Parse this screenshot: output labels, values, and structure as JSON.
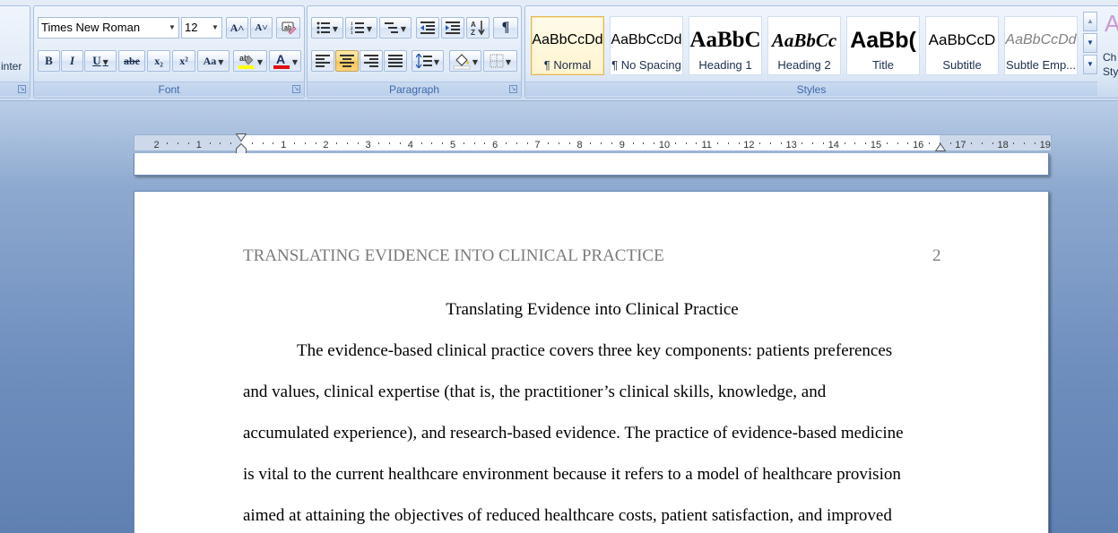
{
  "clipboard": {
    "partial_label": "inter"
  },
  "font_group": {
    "label": "Font",
    "font_name": "Times New Roman",
    "font_size": "12",
    "grow_icon": "A˄",
    "shrink_icon": "A˅",
    "bold": "B",
    "italic": "I",
    "underline": "U",
    "strikethrough": "abe",
    "subscript": "x₂",
    "superscript": "x²",
    "change_case": "Aa",
    "highlight_color": "#ffff00",
    "font_color": "#e01010"
  },
  "paragraph_group": {
    "label": "Paragraph",
    "show_marks": "¶"
  },
  "styles_group": {
    "label": "Styles",
    "tiles": [
      {
        "preview": "AaBbCcDd",
        "name": "¶ Normal"
      },
      {
        "preview": "AaBbCcDd",
        "name": "¶ No Spacing"
      },
      {
        "preview": "AaBbC",
        "name": "Heading 1"
      },
      {
        "preview": "AaBbCc",
        "name": "Heading 2"
      },
      {
        "preview": "AaBb(",
        "name": "Title"
      },
      {
        "preview": "AaBbCcD",
        "name": "Subtitle"
      },
      {
        "preview": "AaBbCcDd",
        "name": "Subtle Emp..."
      }
    ],
    "change_styles_partial": [
      "Ch",
      "Sty"
    ]
  },
  "ruler": {
    "left_labels": [
      "2",
      "1"
    ],
    "right_labels": [
      "1",
      "2",
      "3",
      "4",
      "5",
      "6",
      "7",
      "8",
      "9",
      "10",
      "11",
      "12",
      "13",
      "14",
      "15",
      "16",
      "17",
      "18",
      "19"
    ]
  },
  "document": {
    "running_head": "TRANSLATING EVIDENCE INTO CLINICAL PRACTICE",
    "page_number": "2",
    "title": "Translating Evidence into Clinical Practice",
    "lines": [
      "The evidence-based clinical practice covers three key components: patients preferences",
      "and values, clinical expertise (that is, the practitioner’s clinical skills, knowledge, and",
      "accumulated experience), and research-based evidence. The practice of evidence-based medicine",
      "is vital to the current healthcare environment because it refers to a model of healthcare provision",
      "aimed at attaining the objectives of reduced healthcare costs, patient satisfaction, and improved"
    ]
  }
}
